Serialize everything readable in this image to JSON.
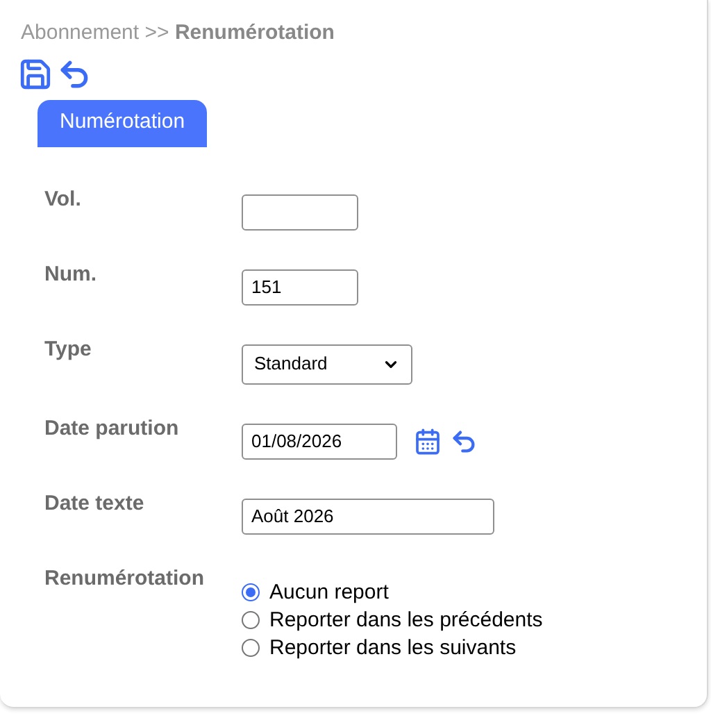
{
  "breadcrumb": {
    "parent": "Abonnement",
    "separator": ">>",
    "current": "Renumérotation"
  },
  "tabs": [
    {
      "label": "Numérotation",
      "selected": true
    }
  ],
  "fields": [
    {
      "kind": "text",
      "label": "Vol."
    },
    {
      "kind": "text",
      "label": "Num.",
      "value": "151"
    },
    {
      "kind": "select",
      "label": "Type",
      "value": "Standard"
    },
    {
      "kind": "date",
      "label": "Date parution",
      "value": "01/08/2026"
    },
    {
      "kind": "wide",
      "label": "Date texte",
      "value": "Août 2026"
    },
    {
      "kind": "radio",
      "label": "Renumérotation",
      "options": [
        {
          "label": "Aucun report",
          "selected": true
        },
        {
          "label": "Reporter dans les précédents",
          "selected": false
        },
        {
          "label": "Reporter dans les suivants",
          "selected": false
        }
      ]
    }
  ]
}
